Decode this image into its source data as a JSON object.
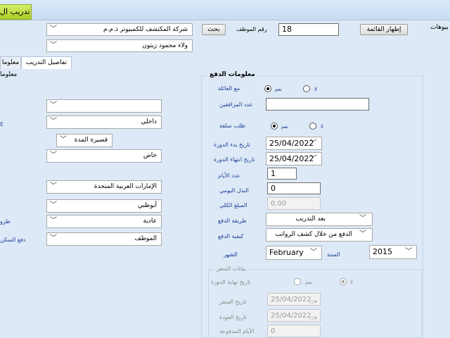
{
  "window": {
    "title": "تدريب ال"
  },
  "header": {
    "right_label": "بيوهات",
    "show_list_button": "إظهار القائمة",
    "employee_no_label": "رقم الموظف",
    "employee_no_value": "18",
    "search_button": "بحث",
    "company_value": "شركة المكتشف للكمبيوتر ذ.م.م",
    "employee_name_value": "ولاء محمود زيتون"
  },
  "tabs": {
    "training_details": "تفاصيل التدريب",
    "info_partial": "معلوما"
  },
  "left_panel": {
    "heading_partial": "معلوما",
    "field_empty": "",
    "field_local": "داخلي",
    "field_short": "قصيرة المدة",
    "field_private": "خاص",
    "field_country": "الإمارات العربية المتحدة",
    "field_city": "أبوظبي",
    "field_normal": "عادية",
    "field_employee": "الموظف",
    "partial_label_1": "ع",
    "partial_label_2": "ظرو",
    "partial_label_3": "دفع السكن"
  },
  "payment": {
    "heading": "معلومات الدفع",
    "family_label": "مع العائلة",
    "yes": "نعم",
    "no": "لا",
    "companions_label": "عدد المرافقين",
    "advance_label": "طلب سلفة",
    "course_start_label": "تاريخ بدء الدورة",
    "course_start_value": "25/04/2022",
    "course_end_label": "تاريخ انتهاء الدورة",
    "course_end_value": "25/04/2022",
    "days_label": "عدد الأيام",
    "days_value": "1",
    "daily_allowance_label": "البدل اليومي",
    "daily_allowance_value": "0",
    "total_label": "المبلغ الكلي",
    "total_value": "0.00",
    "payment_method_label": "طريقة الدفع",
    "payment_method_value": "بعد التدريب",
    "payment_how_label": "كيفية الدفع",
    "payment_how_value": "الدفع من خلال كشف الرواتب",
    "month_label": "الشهر",
    "month_value": "February",
    "year_label": "السنة",
    "year_value": "2015"
  },
  "travel": {
    "heading": "بيانات السفر",
    "course_end_date_label": "تاريخ نهاية الدورة",
    "yes": "نعم",
    "no": "لا",
    "travel_date_label": "تاريخ السفر",
    "travel_date_value": "25/04/2022",
    "return_date_label": "تاريخ العودة",
    "return_date_value": "25/04/2022",
    "paid_days_label": "الأيام المدفوعة",
    "paid_days_value": "0"
  }
}
